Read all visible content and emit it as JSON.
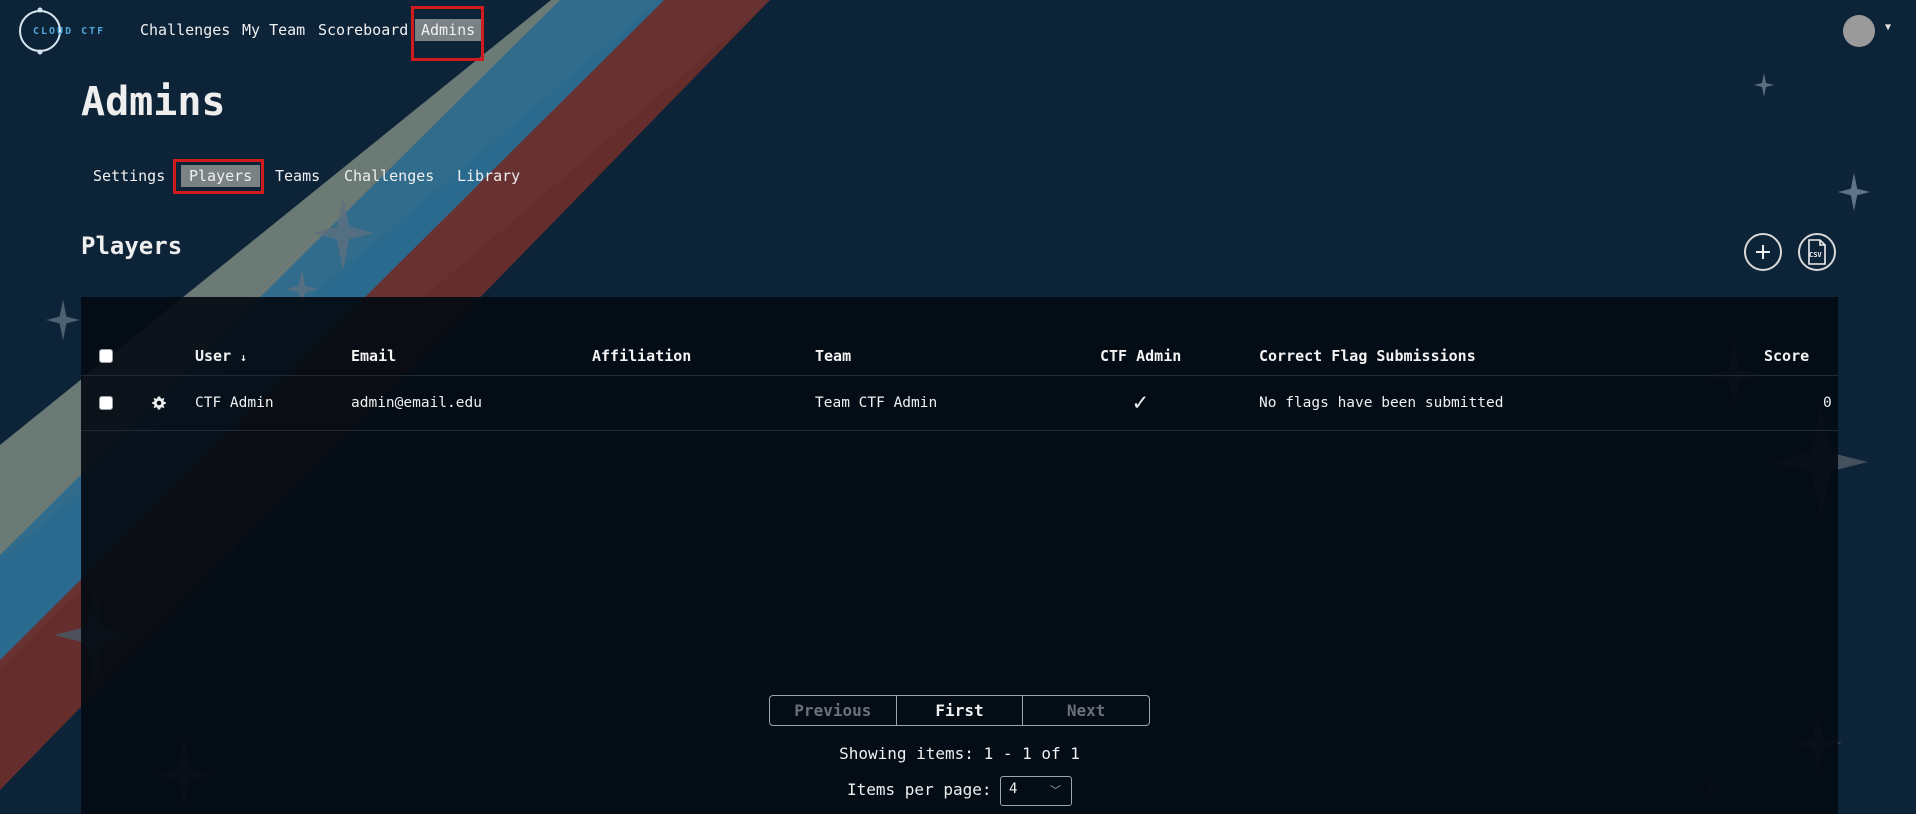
{
  "nav": {
    "logo_text": "CLOUD CTF",
    "links": [
      "Challenges",
      "My Team",
      "Scoreboard",
      "Admins"
    ]
  },
  "page": {
    "title": "Admins",
    "subnav": [
      "Settings",
      "Players",
      "Teams",
      "Challenges",
      "Library"
    ],
    "section_title": "Players",
    "csv_label": "CSV"
  },
  "table": {
    "columns": [
      "User",
      "Email",
      "Affiliation",
      "Team",
      "CTF Admin",
      "Correct Flag Submissions",
      "Score"
    ],
    "sort_indicator": "↓",
    "rows": [
      {
        "user": "CTF Admin",
        "email": "admin@email.edu",
        "affiliation": "",
        "team": "Team CTF Admin",
        "ctf_admin": "✓",
        "flags": "No flags have been submitted",
        "score": "0"
      }
    ]
  },
  "pagination": {
    "previous": "Previous",
    "first": "First",
    "next": "Next",
    "showing": "Showing items: 1 - 1 of 1",
    "per_page_label": "Items per page:",
    "per_page_value": "4"
  },
  "colors": {
    "background": "#0c2338",
    "panel": "#040b13",
    "highlight": "#d01c1c",
    "active_tab": "#7a8286",
    "stripe_gray": "#7e8a80",
    "stripe_blue": "#2b6a8f",
    "stripe_red": "#6a2f2c"
  },
  "icons": [
    "plus-icon",
    "csv-file-icon",
    "gear-icon",
    "checkmark-icon",
    "chevron-down-icon",
    "sort-down-icon",
    "caret-down-icon"
  ]
}
